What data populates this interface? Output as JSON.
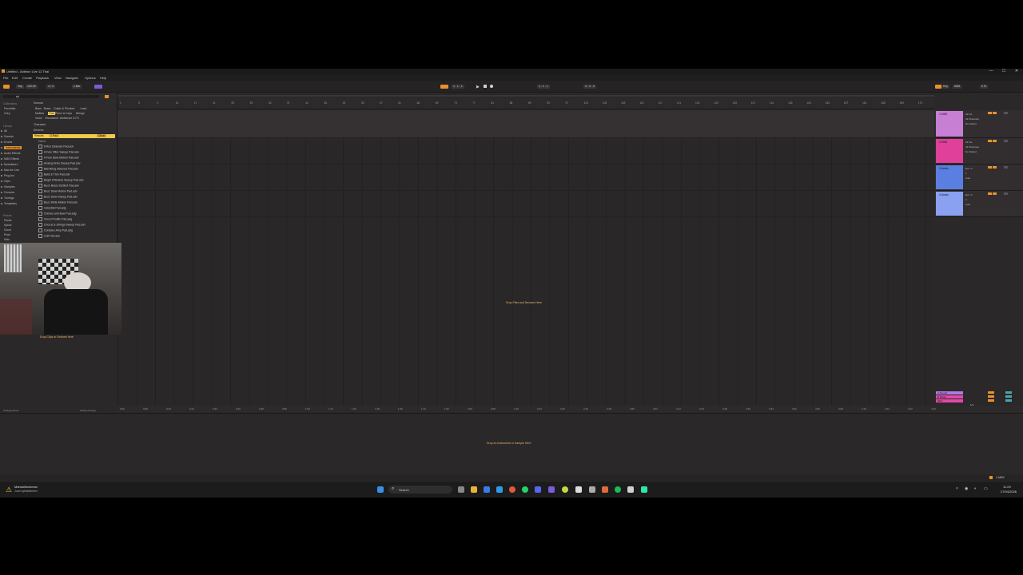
{
  "window": {
    "title": "Untitled - Ableton Live 12 Trial",
    "controls": [
      "—",
      "☐",
      "✕"
    ]
  },
  "menu": [
    "File",
    "Edit",
    "Create",
    "Playback",
    "View",
    "Navigate",
    "Options",
    "Help"
  ],
  "transport": {
    "tap": "Tap",
    "tempo": "120.00",
    "signature": "4 / 4",
    "quantize": "1 Bar",
    "position": "1 . 1 . 1",
    "loop_start": "1 . 1 . 1",
    "loop_len": "4 . 0 . 0",
    "key": "Key",
    "midi": "MIDI",
    "cpu": "2 %"
  },
  "browser": {
    "search_value": "sd",
    "sections": {
      "collections": "Collections",
      "library": "Library",
      "places": "Places"
    },
    "collections": [
      "Favorites",
      "Grey"
    ],
    "library": [
      "All",
      "Sounds",
      "Drums",
      "Instruments",
      "Audio Effects",
      "MIDI Effects",
      "Modulators",
      "Max for Live",
      "Plug-Ins",
      "Clips",
      "Samples",
      "Grooves",
      "Tunings",
      "Templates"
    ],
    "places": [
      "Packs",
      "Splice",
      "Cloud",
      "Push",
      "Sets"
    ],
    "filter_tags_row1": [
      "Bass",
      "Brass",
      "Guitar & Plucked",
      "Lead"
    ],
    "filter_tags_row2": [
      "Mallets",
      "Pad",
      "Piano & Keys",
      "Strings"
    ],
    "filter_tags_row3": [
      "Voice",
      "Woodwind",
      "Ambience & FX"
    ],
    "filter_labels": {
      "sounds": "Sounds",
      "character": "Character",
      "devices": "Devices"
    },
    "results_label": "Results",
    "results_chip": "1 Pad",
    "clear": "Clear",
    "name_header": "Name",
    "files": [
      "8 Rez Detuned Pad.adv",
      "A Few Filter Sweep Pad.adv",
      "A Few Slow Motion Pad.adv",
      "Analog Drive Sweep Pad.adv",
      "Ball Bring Detuned Pad.adv",
      "Bells & Thin Pad.adv",
      "Bright Filterless Sweep Pad.adv",
      "Buzz Brass Distinct Pad.adv",
      "Buzz Slow Motion Pad.adv",
      "Buzz Slow Sweep Pad.adv",
      "Buzz Wide Motion Pad.adv",
      "Celestial Pad.adg",
      "Chimes and Bow Pad.adg",
      "Chord Prolific Pad.adg",
      "Chorus & Strings Sweep Pad.adv",
      "Complex Amp Pad.adg",
      "Cult Pad.adv"
    ]
  },
  "ruler": [
    "1",
    "5",
    "9",
    "13",
    "17",
    "21",
    "25",
    "29",
    "33",
    "37",
    "41",
    "45",
    "49",
    "53",
    "57",
    "61",
    "65",
    "69",
    "73",
    "77",
    "81",
    "85",
    "89",
    "93",
    "97",
    "101",
    "105",
    "109",
    "113",
    "117",
    "121",
    "125",
    "129",
    "133",
    "137",
    "141",
    "145",
    "149",
    "153",
    "157",
    "161",
    "165",
    "169",
    "173"
  ],
  "timecodes": [
    "0:00",
    "0:08",
    "0:16",
    "0:24",
    "0:32",
    "0:40",
    "0:48",
    "0:56",
    "1:04",
    "1:12",
    "1:20",
    "1:28",
    "1:36",
    "1:44",
    "1:52",
    "2:00",
    "2:08",
    "2:16",
    "2:24",
    "2:32",
    "2:40",
    "2:48",
    "2:56",
    "3:04",
    "3:12",
    "3:20",
    "3:28",
    "3:36",
    "3:44",
    "3:52",
    "4:00",
    "4:08",
    "4:16",
    "4:24",
    "4:32",
    "4:40",
    "4:48",
    "4:56",
    "5:04",
    "5:12"
  ],
  "tracks": [
    {
      "name": "1 MIDI",
      "color": "#c77fd4",
      "input": "All Ins",
      "channel": "All Channels",
      "output": "No Output"
    },
    {
      "name": "2 MIDI",
      "color": "#e0409a",
      "input": "All Ins",
      "channel": "All Channels",
      "output": "No Output"
    },
    {
      "name": "3 Audio",
      "color": "#5b7fe0",
      "input": "Ext. In",
      "channel": "1",
      "output": "Auto"
    },
    {
      "name": "4 Audio",
      "color": "#8aa0f0",
      "input": "Ext. In",
      "channel": "2",
      "output": "Auto"
    }
  ],
  "master": {
    "rows": [
      "A Reverb",
      "B Delay",
      "Main"
    ],
    "fraction": "1/1"
  },
  "drop_main": "Drop Files and Devices Here",
  "drop_instrument": "Drop an Instrument or Sample Here",
  "drop_clips": "Drop Clips or Devices here",
  "status_left": "Arrange Panel",
  "status_mid": "Global Arrange",
  "status_right": "1-MIDI",
  "taskbar": {
    "alert_title": "Mahdollisimman",
    "alert_sub": "Juuri nyt/aktiivinen",
    "search": "Search",
    "time": "11.09",
    "date": "27/04/2026"
  },
  "colors": {
    "accent": "#e8912d",
    "yellow": "#f2c94c"
  }
}
